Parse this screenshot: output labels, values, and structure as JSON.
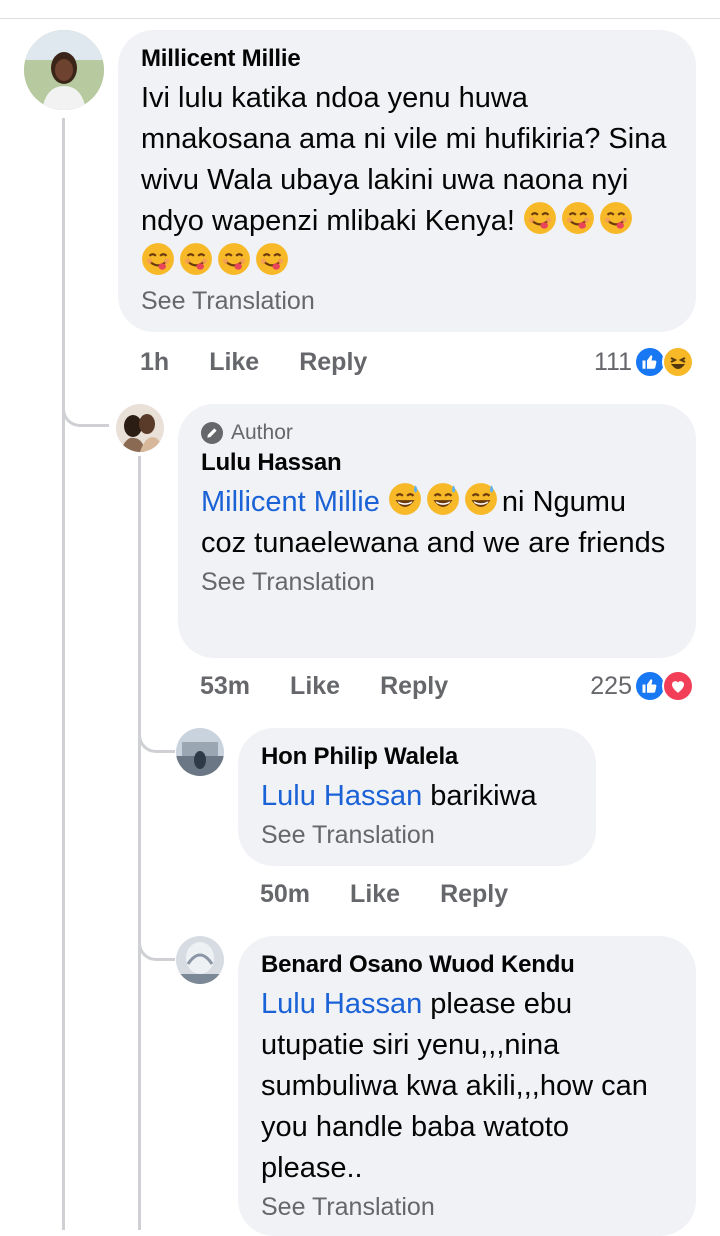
{
  "comments": [
    {
      "author": "Millicent Millie",
      "text": "Ivi lulu katika ndoa yenu huwa mnakosana ama ni vile mi hufikiria? Sina wivu Wala ubaya lakini uwa naona nyi ndyo wapenzi mlibaki Kenya!",
      "emoji_count": 7,
      "emoji_name": "yum-face",
      "see_translation": "See Translation",
      "time": "1h",
      "like": "Like",
      "reply": "Reply",
      "reaction_count": "111",
      "reactions": [
        "like",
        "haha"
      ]
    },
    {
      "author_badge": "Author",
      "author": "Lulu Hassan",
      "mention": "Millicent Millie",
      "emoji_name": "grinning-sweat-face",
      "text_after_emoji": "ni",
      "text": "Ngumu coz tunaelewana and we are friends",
      "see_translation": "See Translation",
      "time": "53m",
      "like": "Like",
      "reply": "Reply",
      "reaction_count": "225",
      "reactions": [
        "like",
        "love"
      ]
    },
    {
      "author": "Hon Philip Walela",
      "mention": "Lulu Hassan",
      "text": "barikiwa",
      "see_translation": "See Translation",
      "time": "50m",
      "like": "Like",
      "reply": "Reply"
    },
    {
      "author": "Benard Osano Wuod Kendu",
      "mention": "Lulu Hassan",
      "text_line1": "please ebu",
      "text_rest": "utupatie siri yenu,,,nina sumbuliwa kwa akili,,,how can you handle baba watoto please..",
      "see_translation": "See Translation"
    }
  ],
  "colors": {
    "bubble": "#f0f2f5",
    "mention": "#1a62d6",
    "secondary_text": "#65676b",
    "like_blue": "#1877f2",
    "love_red": "#f33e58",
    "haha_yellow": "#f7b928"
  }
}
